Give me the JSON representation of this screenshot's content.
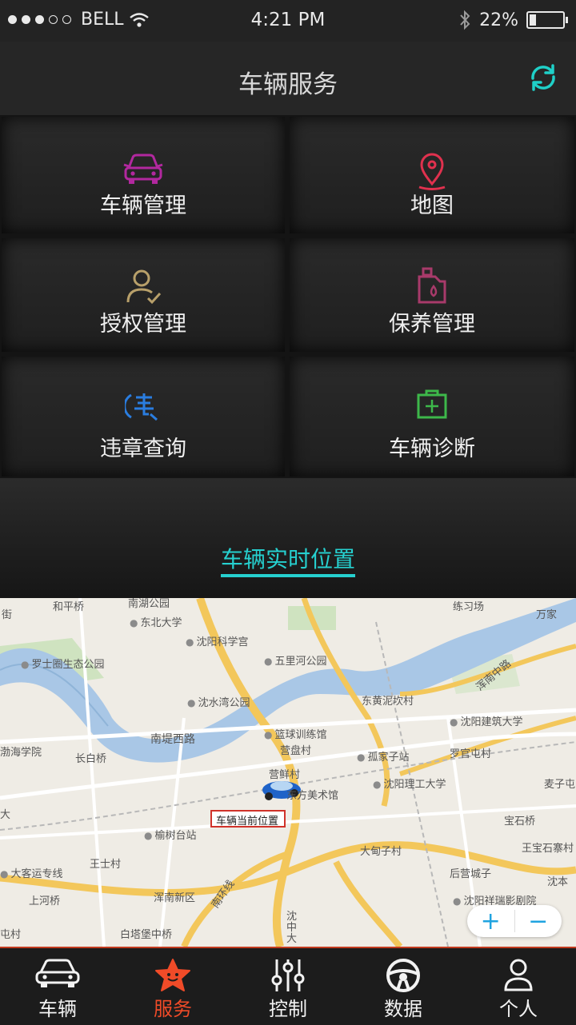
{
  "status_bar": {
    "carrier": "BELL",
    "time": "4:21 PM",
    "battery": "22%",
    "battery_level": 0.22
  },
  "header": {
    "title": "车辆服务",
    "refresh_icon": "refresh-icon"
  },
  "tiles": [
    {
      "label": "车辆管理",
      "icon": "car-front-icon",
      "color": "#b2289f"
    },
    {
      "label": "地图",
      "icon": "map-pin-icon",
      "color": "#e0314e"
    },
    {
      "label": "授权管理",
      "icon": "user-check-icon",
      "color": "#b8a06a"
    },
    {
      "label": "保养管理",
      "icon": "oil-bottle-icon",
      "color": "#a83a6a"
    },
    {
      "label": "违章查询",
      "icon": "violation-search-icon",
      "color": "#2a7de0"
    },
    {
      "label": "车辆诊断",
      "icon": "first-aid-kit-icon",
      "color": "#3db84a"
    }
  ],
  "realtime": {
    "label": "车辆实时位置",
    "color": "#26d0cf"
  },
  "map": {
    "car_marker_label": "车辆当前位置",
    "zoom_in": "+",
    "zoom_out": "−",
    "labels": [
      "和平桥",
      "南湖公园",
      "东北大学",
      "沈阳科学宫",
      "罗士圈生态公园",
      "五里河公园",
      "沈水湾公园",
      "东黄泥坎村",
      "沈阳建筑大学",
      "浑南中路",
      "南堤西路",
      "篮球训练馆",
      "营盘村",
      "孤家子站",
      "罗官屯村",
      "渤海学院",
      "长白桥",
      "营鲜村",
      "沈阳理工大学",
      "麦子屯",
      "东方美术馆",
      "宝石桥",
      "榆树台站",
      "大甸子村",
      "王宝石寨村",
      "王士村",
      "大客运专线",
      "后营城子",
      "上河桥",
      "浑南新区",
      "沈阳祥瑞影剧院",
      "白塔堡中桥",
      "南环线",
      "沈中大",
      "练习场",
      "万家",
      "街",
      "屯村",
      "大",
      "沈本"
    ]
  },
  "tabs": [
    {
      "label": "车辆",
      "icon": "car-icon",
      "active": false
    },
    {
      "label": "服务",
      "icon": "star-smile-icon",
      "active": true
    },
    {
      "label": "控制",
      "icon": "sliders-icon",
      "active": false
    },
    {
      "label": "数据",
      "icon": "steering-wheel-icon",
      "active": false
    },
    {
      "label": "个人",
      "icon": "person-icon",
      "active": false
    }
  ]
}
